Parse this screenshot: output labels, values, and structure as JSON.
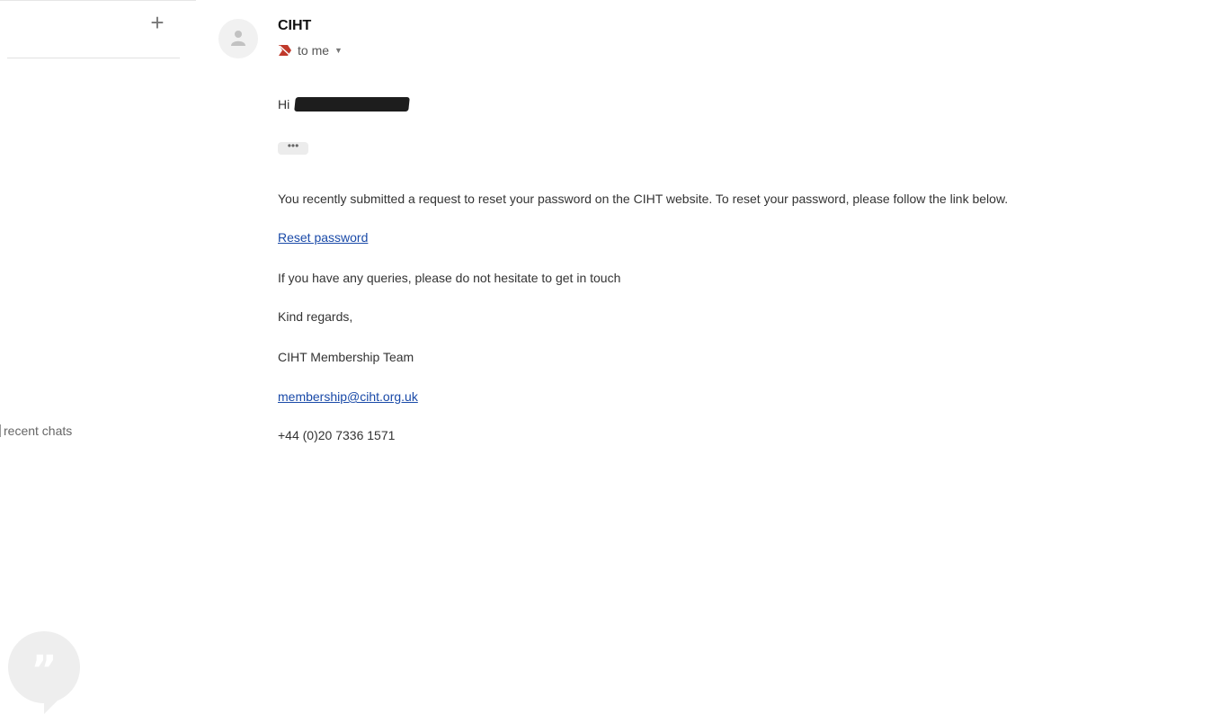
{
  "sidebar": {
    "add_icon": "plus-icon",
    "hangouts_icon": "chat-quote-icon",
    "recent_chats_label": "recent chats"
  },
  "message": {
    "sender": "CIHT",
    "recipient_label": "to me",
    "greeting": "Hi",
    "ellipsis": "•••",
    "paragraph_1": "You recently submitted a request to reset your password on the CIHT website. To reset your password, please follow the link below.",
    "reset_link": "Reset password",
    "paragraph_2": "If you have any queries, please do not hesitate to get in touch",
    "closing": "Kind regards,",
    "signature_team": "CIHT Membership Team",
    "signature_email": "membership@ciht.org.uk",
    "signature_phone": "+44 (0)20 7336 1571"
  },
  "colors": {
    "link": "#1a4aa8",
    "important_marker": "#c0392b"
  }
}
